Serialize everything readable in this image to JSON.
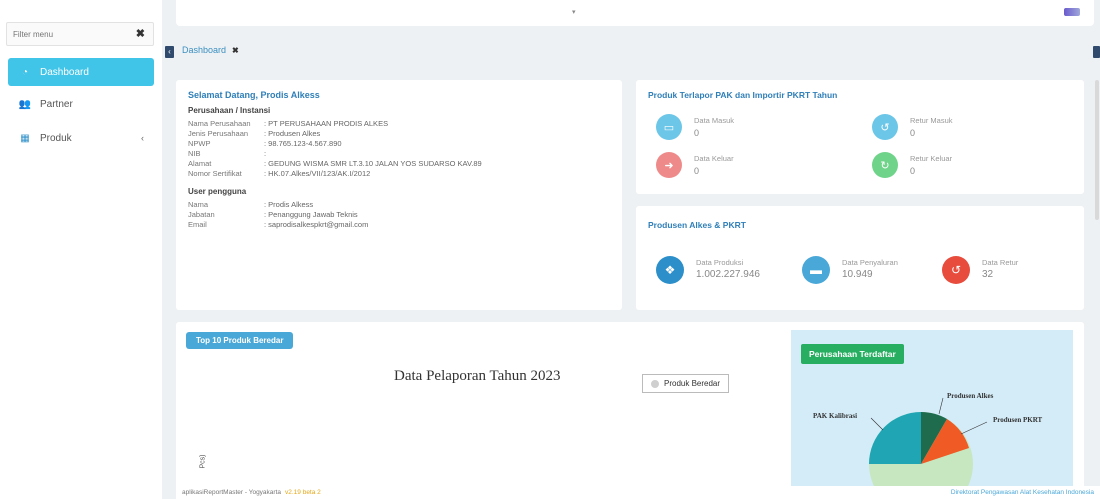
{
  "sidebar": {
    "filter_placeholder": "Filter menu",
    "items": [
      {
        "label": "Dashboard",
        "icon": "dashboard-icon"
      },
      {
        "label": "Partner",
        "icon": "users-icon"
      },
      {
        "label": "Produk",
        "icon": "grid-icon"
      }
    ]
  },
  "tabs": {
    "active": "Dashboard",
    "close": "✖"
  },
  "welcome": {
    "title": "Selamat Datang, Prodis Alkess",
    "company_header": "Perusahaan / Instansi",
    "company_rows": [
      {
        "k": "Nama Perusahaan",
        "v": ": PT PERUSAHAAN PRODIS ALKES"
      },
      {
        "k": "Jenis Perusahaan",
        "v": ": Produsen Alkes"
      },
      {
        "k": "NPWP",
        "v": ": 98.765.123-4.567.890"
      },
      {
        "k": "NIB",
        "v": ":"
      },
      {
        "k": "Alamat",
        "v": ": GEDUNG WISMA SMR LT.3.10 JALAN YOS SUDARSO KAV.89"
      },
      {
        "k": "Nomor Sertifikat",
        "v": ": HK.07.Alkes/VII/123/AK.I/2012"
      }
    ],
    "user_header": "User pengguna",
    "user_rows": [
      {
        "k": "Nama",
        "v": ": Prodis Alkess"
      },
      {
        "k": "Jabatan",
        "v": ": Penanggung Jawab Teknis"
      },
      {
        "k": "Email",
        "v": ": saprodisalkespkrt@gmail.com"
      }
    ]
  },
  "prodpak": {
    "title": "Produk Terlapor PAK dan Importir PKRT Tahun",
    "stats": [
      {
        "label": "Data Masuk",
        "value": "0",
        "color": "#6cc6e8"
      },
      {
        "label": "Retur Masuk",
        "value": "0",
        "color": "#6cc6e8"
      },
      {
        "label": "Data Keluar",
        "value": "0",
        "color": "#ef8a8a"
      },
      {
        "label": "Retur Keluar",
        "value": "0",
        "color": "#6fd48a"
      }
    ]
  },
  "produsen": {
    "title": "Produsen Alkes & PKRT",
    "stats": [
      {
        "label": "Data Produksi",
        "value": "1.002.227.946",
        "color": "#2c8fc9"
      },
      {
        "label": "Data Penyaluran",
        "value": "10.949",
        "color": "#4aa8d8"
      },
      {
        "label": "Data Retur",
        "value": "32",
        "color": "#e74c3c"
      }
    ]
  },
  "chart": {
    "pill": "Top 10 Produk Beredar",
    "title": "Data Pelaporan Tahun 2023",
    "legend": "Produk Beredar",
    "ylabel": "Pcs)"
  },
  "company_chart": {
    "pill": "Perusahaan Terdaftar",
    "labels": [
      "Produsen Alkes",
      "Produsen PKRT",
      "PAK Kalibrasi"
    ]
  },
  "footer": {
    "left": "aplikasiReportMaster - Yogyakarta",
    "version": "v2.19 beta 2",
    "right": "Direktorat Pengawasan Alat Kesehatan Indonesia"
  }
}
